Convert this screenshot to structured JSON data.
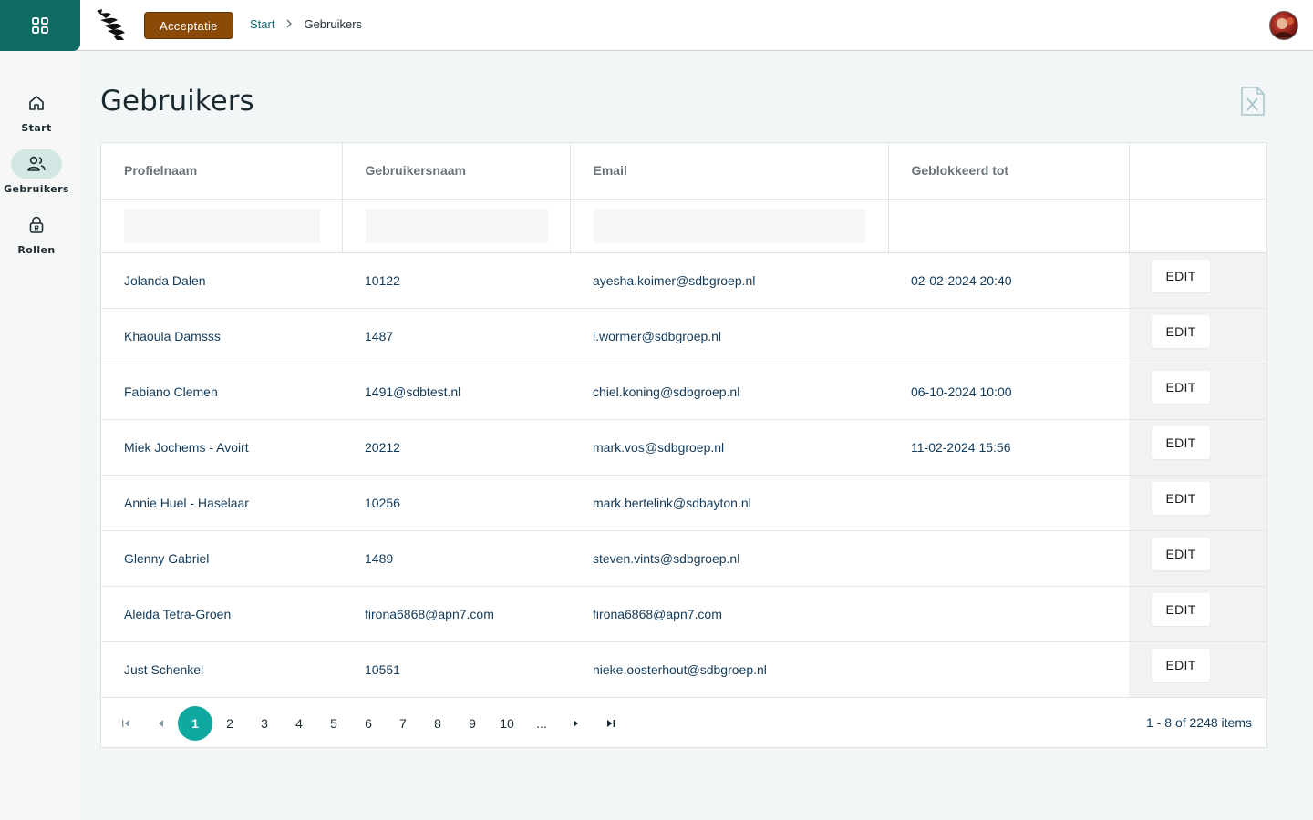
{
  "header": {
    "environment_label": "Acceptatie",
    "breadcrumb": {
      "home": "Start",
      "current": "Gebruikers"
    }
  },
  "sidebar": {
    "items": [
      {
        "label": "Start",
        "icon": "home-icon",
        "active": false
      },
      {
        "label": "Gebruikers",
        "icon": "users-icon",
        "active": true
      },
      {
        "label": "Rollen",
        "icon": "lock-icon",
        "active": false
      }
    ]
  },
  "page": {
    "title": "Gebruikers"
  },
  "grid": {
    "columns": [
      "Profielnaam",
      "Gebruikersnaam",
      "Email",
      "Geblokkeerd tot",
      ""
    ],
    "filters": {
      "profielnaam": "",
      "gebruikersnaam": "",
      "email": ""
    },
    "edit_label": "EDIT",
    "rows": [
      {
        "profielnaam": "Jolanda Dalen",
        "gebruikersnaam": "10122",
        "email": "ayesha.koimer@sdbgroep.nl",
        "geblokkeerd_tot": "02-02-2024 20:40"
      },
      {
        "profielnaam": "Khaoula Damsss",
        "gebruikersnaam": "1487",
        "email": "l.wormer@sdbgroep.nl",
        "geblokkeerd_tot": ""
      },
      {
        "profielnaam": "Fabiano Clemen",
        "gebruikersnaam": "1491@sdbtest.nl",
        "email": "chiel.koning@sdbgroep.nl",
        "geblokkeerd_tot": "06-10-2024 10:00"
      },
      {
        "profielnaam": "Miek Jochems - Avoirt",
        "gebruikersnaam": "20212",
        "email": "mark.vos@sdbgroep.nl",
        "geblokkeerd_tot": "11-02-2024 15:56"
      },
      {
        "profielnaam": "Annie Huel - Haselaar",
        "gebruikersnaam": "10256",
        "email": "mark.bertelink@sdbayton.nl",
        "geblokkeerd_tot": ""
      },
      {
        "profielnaam": "Glenny Gabriel",
        "gebruikersnaam": "1489",
        "email": "steven.vints@sdbgroep.nl",
        "geblokkeerd_tot": ""
      },
      {
        "profielnaam": "Aleida Tetra-Groen",
        "gebruikersnaam": "firona6868@apn7.com",
        "email": "firona6868@apn7.com",
        "geblokkeerd_tot": ""
      },
      {
        "profielnaam": "Just Schenkel",
        "gebruikersnaam": "10551",
        "email": "nieke.oosterhout@sdbgroep.nl",
        "geblokkeerd_tot": ""
      }
    ]
  },
  "pager": {
    "pages": [
      "1",
      "2",
      "3",
      "4",
      "5",
      "6",
      "7",
      "8",
      "9",
      "10",
      "..."
    ],
    "current_page": "1",
    "info": "1 - 8 of 2248 items"
  },
  "colors": {
    "brand_teal": "#0e6b61",
    "environment_badge": "#8a4b08",
    "active_page": "#0fa8a0",
    "active_nav_pill": "#d3e7e5"
  }
}
